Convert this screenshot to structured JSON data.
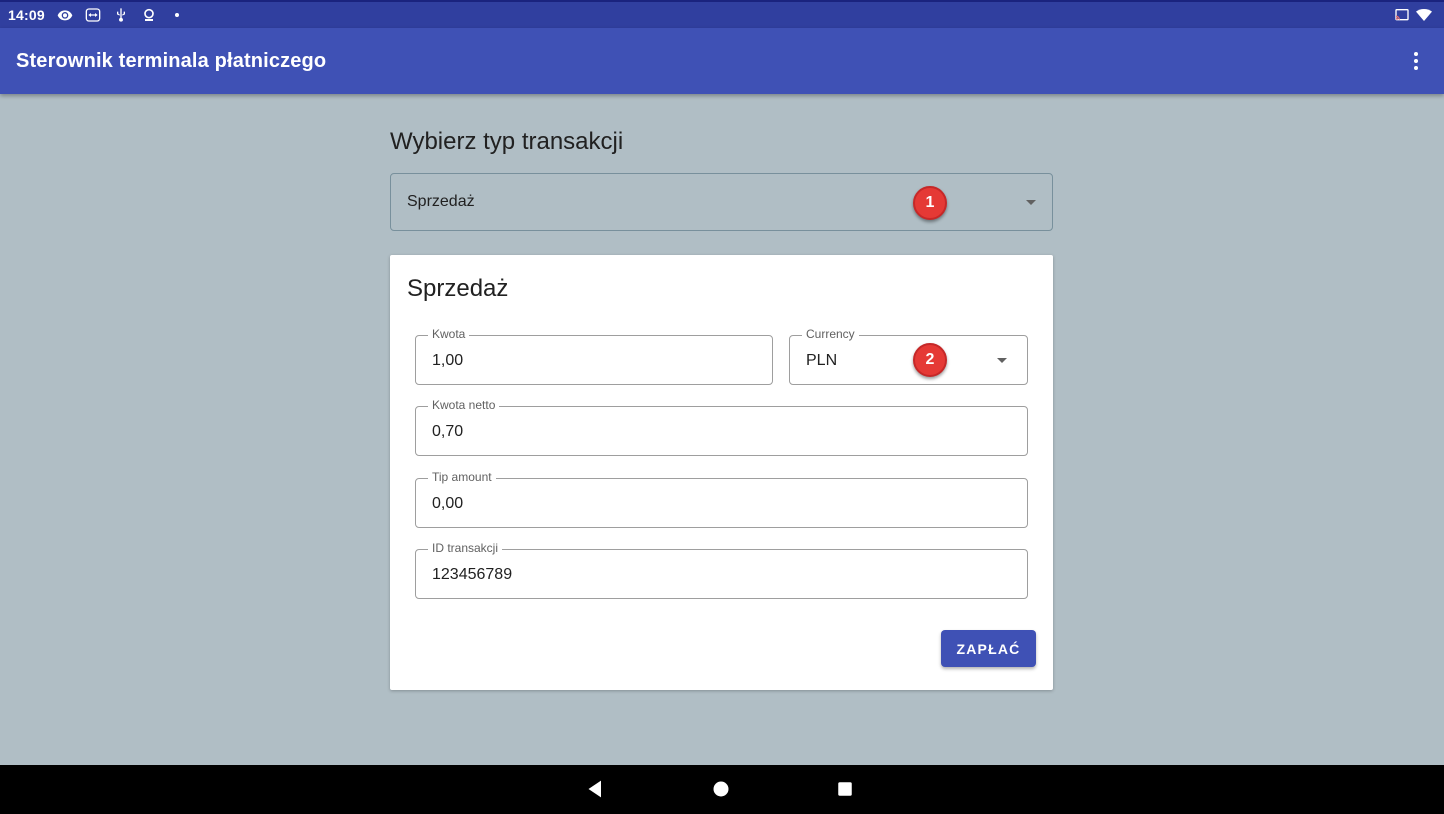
{
  "status_bar": {
    "time": "14:09",
    "icons_left": [
      "eye-icon",
      "teamviewer-icon",
      "usb-icon",
      "location-icon",
      "dot-icon"
    ],
    "icons_right": [
      "cast-icon",
      "wifi-icon"
    ]
  },
  "app_bar": {
    "title": "Sterownik terminala płatniczego",
    "menu_icon": "more-vert-icon"
  },
  "transaction_type": {
    "heading": "Wybierz typ transakcji",
    "selected": "Sprzedaż"
  },
  "badges": [
    "1",
    "2"
  ],
  "card": {
    "title": "Sprzedaż",
    "fields": {
      "amount": {
        "label": "Kwota",
        "value": "1,00"
      },
      "currency": {
        "label": "Currency",
        "value": "PLN"
      },
      "net_amount": {
        "label": "Kwota netto",
        "value": "0,70"
      },
      "tip_amount": {
        "label": "Tip amount",
        "value": "0,00"
      },
      "transaction_id": {
        "label": "ID transakcji",
        "value": "123456789"
      }
    },
    "pay_button": "ZAPŁAĆ"
  },
  "nav_bar": {
    "buttons": [
      "back-icon",
      "home-icon",
      "recents-icon"
    ]
  },
  "colors": {
    "primary": "#3f51b5",
    "primary_dark": "#303f9f",
    "background": "#b0bec5",
    "badge": "#e53935"
  }
}
